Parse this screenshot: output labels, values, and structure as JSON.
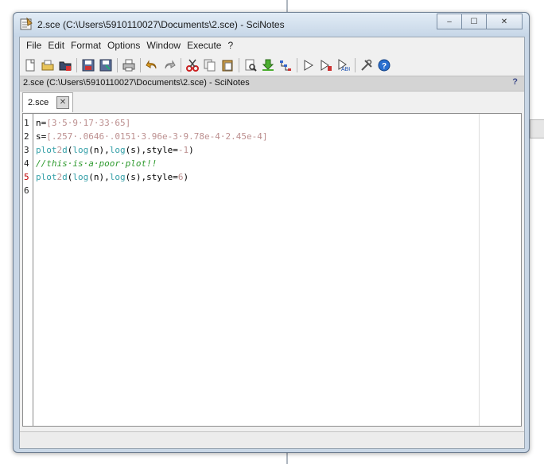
{
  "window": {
    "title": "2.sce (C:\\Users\\5910110027\\Documents\\2.sce) - SciNotes",
    "buttons": {
      "minimize": "–",
      "maximize": "☐",
      "close": "✕"
    }
  },
  "menu": [
    "File",
    "Edit",
    "Format",
    "Options",
    "Window",
    "Execute",
    "?"
  ],
  "toolbar_icons": [
    "new-file-icon",
    "open-file-icon",
    "open-folder-icon",
    "save-icon",
    "save-as-icon",
    "print-icon",
    "undo-icon",
    "redo-icon",
    "cut-icon",
    "copy-icon",
    "paste-icon",
    "find-replace-icon",
    "load-into-scilab-icon",
    "execute-file-icon",
    "execute-icon",
    "execute-until-icon",
    "execute-selection-icon",
    "preferences-icon",
    "help-icon"
  ],
  "pathbar": {
    "text": "2.sce (C:\\Users\\5910110027\\Documents\\2.sce) - SciNotes",
    "help": "?"
  },
  "tab": {
    "label": "2.sce"
  },
  "editor": {
    "line_numbers": [
      "1",
      "2",
      "3",
      "4",
      "5",
      "6"
    ],
    "lines": [
      "n=[3·5·9·17·33·65]",
      "s=[.257·.0646·.0151·3.96e-3·9.78e-4·2.45e-4]",
      "plot2d(log(n),log(s),style=-1)",
      "//this·is·a·poor·plot!!",
      "plot2d(log(n),log(s),style=6)",
      ""
    ]
  },
  "colors": {
    "function": "#35a0a8",
    "number": "#bc8f8f",
    "comment": "#2e9a2e",
    "error_line_number": "#c00000"
  }
}
